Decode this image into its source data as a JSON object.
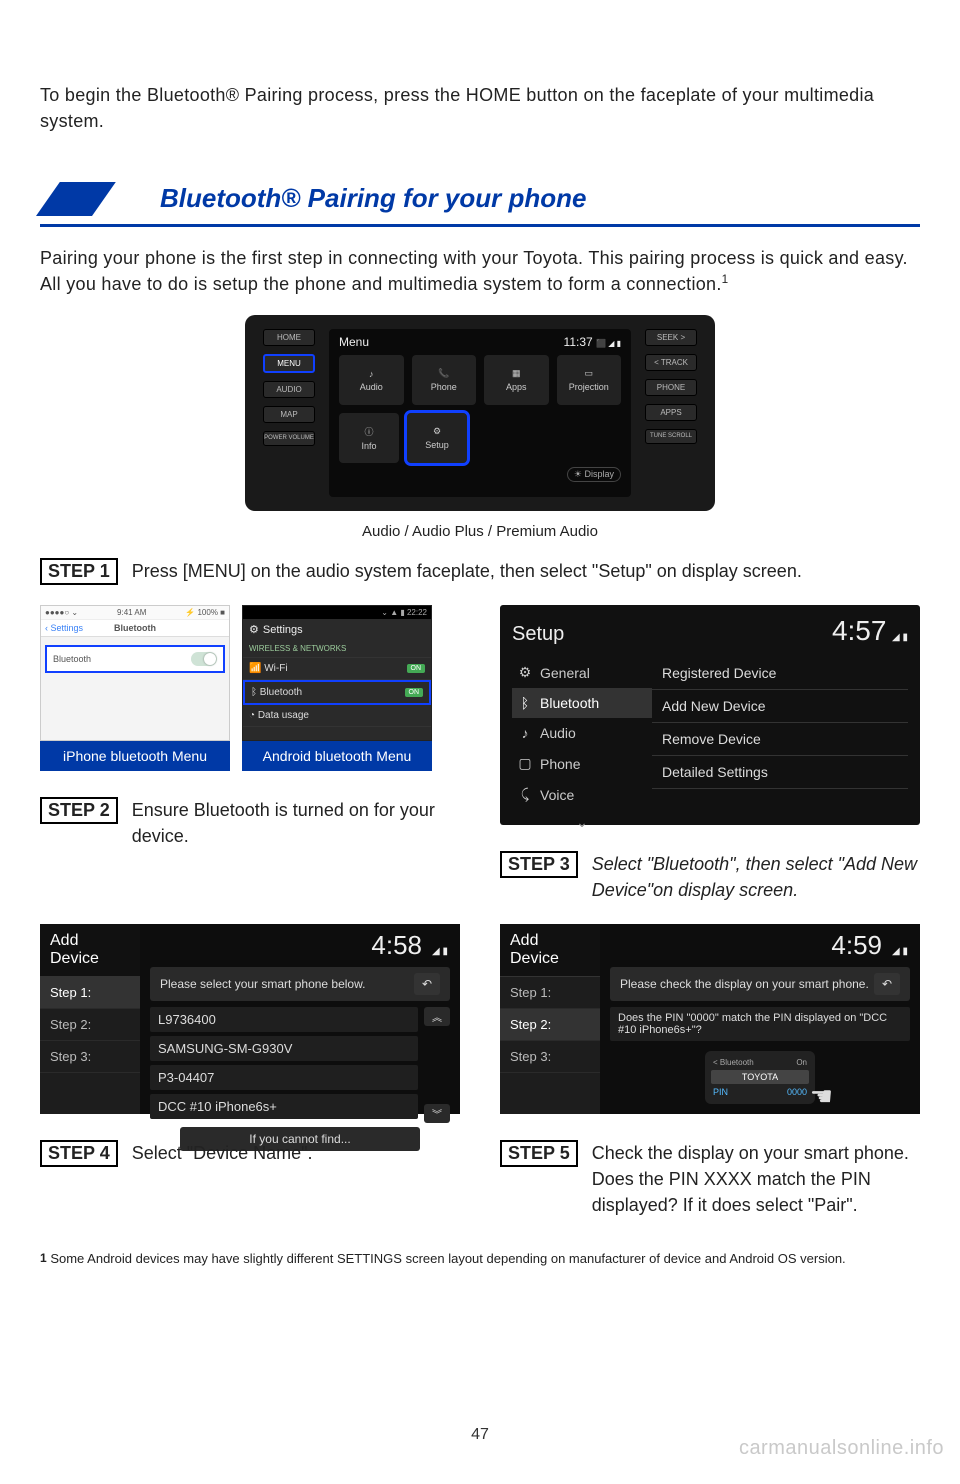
{
  "intro": "To begin the Bluetooth® Pairing process, press the HOME button on the faceplate of your multimedia system.",
  "section_title": "Bluetooth® Pairing for your phone",
  "para1": "Pairing your phone is the first step in connecting with your Toyota. This pairing process is quick and easy. All you have to do is setup the phone and multimedia system to form a connection.",
  "para1_sup": "1",
  "dash": {
    "left_buttons": [
      "HOME",
      "MENU",
      "AUDIO",
      "MAP",
      "POWER VOLUME"
    ],
    "right_buttons": [
      "SEEK >",
      "< TRACK",
      "PHONE",
      "APPS",
      "TUNE SCROLL"
    ],
    "screen_title": "Menu",
    "screen_time": "11:37",
    "tiles": [
      "Audio",
      "Phone",
      "Apps",
      "Projection"
    ],
    "tiles2": [
      "Info",
      "Setup"
    ],
    "display_btn": "Display",
    "caption": "Audio / Audio Plus / Premium Audio"
  },
  "steps": {
    "s1": {
      "badge": "STEP 1",
      "text": "Press [MENU] on the audio system faceplate, then select \"Setup\" on display screen."
    },
    "s2": {
      "badge": "STEP 2",
      "text": "Ensure Bluetooth is turned on for your device."
    },
    "s3": {
      "badge": "STEP 3",
      "text": "Select \"Bluetooth\", then select \"Add New Device\"on display screen."
    },
    "s4": {
      "badge": "STEP 4",
      "text": "Select \"Device Name\"."
    },
    "s5": {
      "badge": "STEP 5",
      "text": "Check the display on your smart phone. Does the PIN XXXX match the PIN displayed? If it does select \"Pair\"."
    }
  },
  "iphone": {
    "status_left": "●●●●○ ⌄",
    "status_time": "9:41 AM",
    "status_right": "⚡ 100% ■",
    "back": "Settings",
    "title": "Bluetooth",
    "row_label": "Bluetooth",
    "caption": "iPhone bluetooth Menu"
  },
  "android": {
    "status_right": "⌄ ▲ ▮ 22:22",
    "settings": "Settings",
    "section": "WIRELESS & NETWORKS",
    "rows": [
      {
        "icon": "📶",
        "label": "Wi-Fi",
        "state": "ON"
      },
      {
        "icon": "ᛒ",
        "label": "Bluetooth",
        "state": "ON"
      },
      {
        "icon": "◔",
        "label": "Data usage",
        "state": ""
      }
    ],
    "caption": "Android bluetooth Menu"
  },
  "setup": {
    "title": "Setup",
    "time": "4:57",
    "left": [
      {
        "icon": "⚙",
        "label": "General"
      },
      {
        "icon": "ᛒ",
        "label": "Bluetooth"
      },
      {
        "icon": "♪",
        "label": "Audio"
      },
      {
        "icon": "▢",
        "label": "Phone"
      },
      {
        "icon": "⤹",
        "label": "Voice"
      }
    ],
    "right": [
      "Registered Device",
      "Add New Device",
      "Remove Device",
      "Detailed Settings"
    ]
  },
  "add_device_4": {
    "title": "Add Device",
    "time": "4:58",
    "hint": "Please select your smart phone below.",
    "steps": [
      "Step 1:",
      "Step 2:",
      "Step 3:"
    ],
    "devices": [
      "L9736400",
      "SAMSUNG-SM-G930V",
      "P3-04407",
      "DCC #10 iPhone6s+"
    ],
    "cannot": "If you cannot find..."
  },
  "add_device_5": {
    "title": "Add Device",
    "time": "4:59",
    "hint": "Please check the display on your smart phone.",
    "steps": [
      "Step 1:",
      "Step 2:",
      "Step 3:"
    ],
    "confirm": "Does the PIN \"0000\" match the PIN displayed on \"DCC #10 iPhone6s+\"?",
    "pm_line1_l": "< Bluetooth",
    "pm_line1_r": "On",
    "pm_brand": "TOYOTA",
    "pm_pin_l": "PIN",
    "pm_pin_r": "0000"
  },
  "footnote": "Some Android devices may have slightly different SETTINGS screen layout depending on manufacturer of device and Android OS version.",
  "footnote_num": "1",
  "page_number": "47",
  "watermark": "carmanualsonline.info"
}
